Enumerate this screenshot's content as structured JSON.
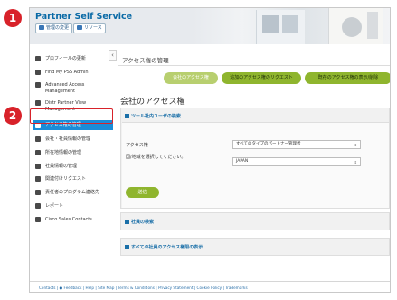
{
  "header": {
    "title": "Partner Self Service",
    "btn_settings": "管理の変更",
    "btn_resources": "リソース"
  },
  "sidebar": {
    "items": [
      {
        "label": "プロフィールの更新",
        "icon": "person-icon"
      },
      {
        "label": "Find My PSS Admin",
        "icon": "search-person-icon"
      },
      {
        "label": "Advanced Access Management",
        "icon": "person-gear-icon"
      },
      {
        "label": "Distr Partner View Management",
        "icon": "person-view-icon"
      },
      {
        "label": "アクセス権の管理",
        "icon": "group-lock-icon",
        "active": true
      },
      {
        "label": "会社・社員情報の管理",
        "icon": "building-icon"
      },
      {
        "label": "所在地情報の管理",
        "icon": "location-icon"
      },
      {
        "label": "社員情報の管理",
        "icon": "people-icon"
      },
      {
        "label": "関連付けリクエスト",
        "icon": "link-icon"
      },
      {
        "label": "責任者のプログラム連絡先",
        "icon": "contact-icon"
      },
      {
        "label": "レポート",
        "icon": "report-icon"
      },
      {
        "label": "Cisco Sales Contacts",
        "icon": "sales-contact-icon"
      }
    ]
  },
  "main": {
    "page_title": "アクセス権の管理",
    "pills": [
      "会社のアクセス権",
      "追加のアクセス権のリクエスト",
      "既存のアクセス権の表示/削除"
    ],
    "heading": "会社のアクセス権",
    "search_section": {
      "title": "ツール社内ユーザの検索",
      "access_label": "アクセス権",
      "access_value": "すべてのタイプのパートナー管理者",
      "country_label": "国/地域を選択してください。",
      "country_value": "JAPAN",
      "submit_label": "送信"
    },
    "employee_search_title": "社員の検索",
    "show_all_title": "すべての社員のアクセス権限の表示"
  },
  "footer": {
    "links": "Contacts | ● Feedback | Help | Site Map | Terms & Conditions | Privacy Statement | Cookie Policy | Trademarks"
  },
  "callouts": [
    "1",
    "2"
  ],
  "colors": {
    "accent_blue": "#1a8cd8",
    "link_blue": "#1a6fa8",
    "button_green": "#8fb52e",
    "callout_red": "#d8222a"
  }
}
